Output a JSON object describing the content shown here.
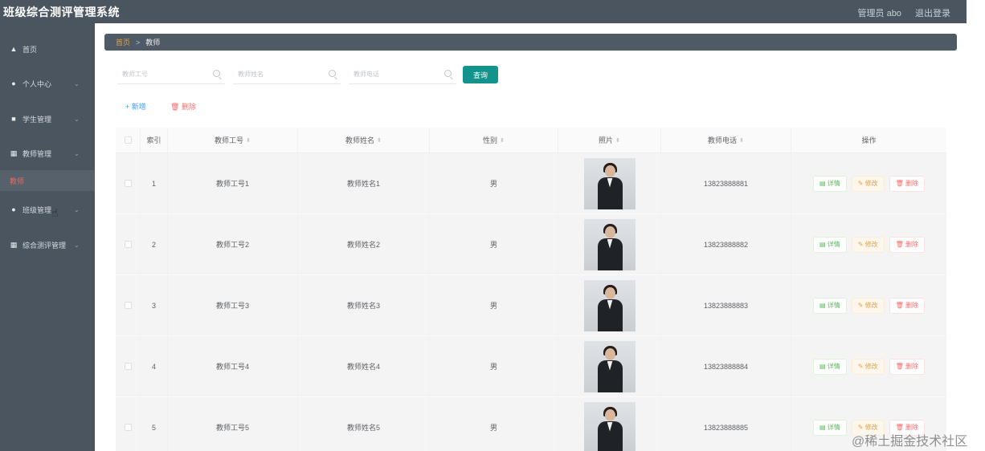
{
  "app": {
    "title": "班级综合测评管理系统",
    "user_label": "管理员 abo",
    "logout_label": "退出登录"
  },
  "sidebar": {
    "items": [
      {
        "label": "首页",
        "icon": "home-icon"
      },
      {
        "label": "个人中心",
        "icon": "user-icon"
      },
      {
        "label": "学生管理",
        "icon": "chat-icon"
      },
      {
        "label": "教师管理",
        "icon": "grid-icon"
      },
      {
        "label": "班级管理",
        "icon": "user-icon"
      },
      {
        "label": "综合测评管理",
        "icon": "grid-icon"
      }
    ],
    "active_subitem": "教师"
  },
  "breadcrumb": {
    "home": "首页",
    "separator": ">",
    "current": "教师"
  },
  "search": {
    "teacher_no_placeholder": "教师工号",
    "teacher_name_placeholder": "教师姓名",
    "teacher_phone_placeholder": "教师电话",
    "query_label": "查询"
  },
  "actions": {
    "add_label": "+ 新增",
    "delete_label": "删除"
  },
  "table": {
    "headers": {
      "index": "索引",
      "teacher_no": "教师工号",
      "teacher_name": "教师姓名",
      "gender": "性别",
      "photo": "照片",
      "phone": "教师电话",
      "operation": "操作"
    },
    "rows": [
      {
        "index": "1",
        "teacher_no": "教师工号1",
        "teacher_name": "教师姓名1",
        "gender": "男",
        "phone": "13823888881"
      },
      {
        "index": "2",
        "teacher_no": "教师工号2",
        "teacher_name": "教师姓名2",
        "gender": "男",
        "phone": "13823888882"
      },
      {
        "index": "3",
        "teacher_no": "教师工号3",
        "teacher_name": "教师姓名3",
        "gender": "男",
        "phone": "13823888883"
      },
      {
        "index": "4",
        "teacher_no": "教师工号4",
        "teacher_name": "教师姓名4",
        "gender": "男",
        "phone": "13823888884"
      },
      {
        "index": "5",
        "teacher_no": "教师工号5",
        "teacher_name": "教师姓名5",
        "gender": "男",
        "phone": "13823888885"
      }
    ],
    "row_actions": {
      "detail": "详情",
      "edit": "修改",
      "delete": "删除"
    }
  },
  "watermark": "@稀土掘金技术社区",
  "colors": {
    "sidebar_bg": "#4a5560",
    "query_button": "#13938c",
    "active_menu_text": "#e86a62",
    "breadcrumb_home": "#e3a14a"
  }
}
